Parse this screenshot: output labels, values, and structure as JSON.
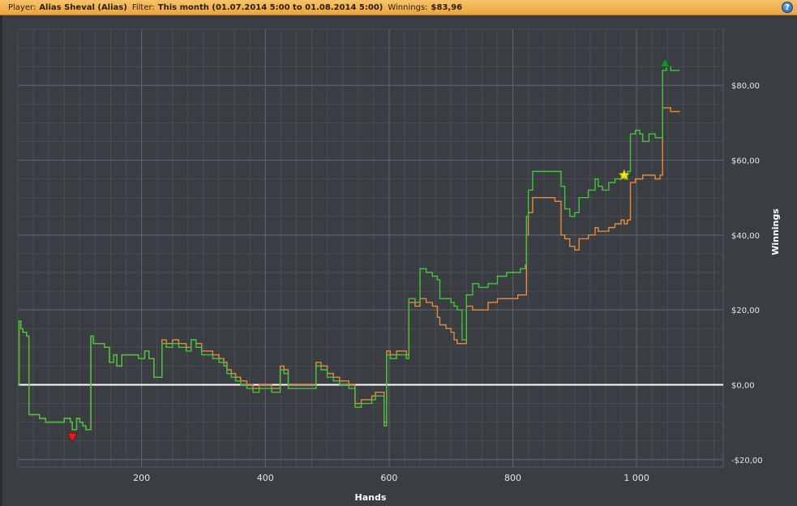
{
  "header": {
    "player_label": "Player:",
    "player_value": "Alias Sheval (Alias)",
    "filter_label": "Filter:",
    "filter_value": "This month (01.07.2014 5:00 to 01.08.2014 5:00)",
    "winnings_label": "Winnings:",
    "winnings_value": "$83,96",
    "help_icon": "help-icon",
    "accent_color": "#f0aa45"
  },
  "chart_data": {
    "type": "line",
    "title": "",
    "xlabel": "Hands",
    "ylabel": "Winnings",
    "xlim": [
      0,
      1140
    ],
    "ylim": [
      -22,
      95
    ],
    "xticks": [
      200,
      400,
      600,
      800,
      1000
    ],
    "xtick_labels": [
      "200",
      "400",
      "600",
      "800",
      "1 000"
    ],
    "yticks": [
      -20,
      0,
      20,
      40,
      60,
      80
    ],
    "ytick_labels": [
      "-$20,00",
      "$0,00",
      "$20,00",
      "$40,00",
      "$60,00",
      "$80,00"
    ],
    "grid": true,
    "background_color": "#3a3d42",
    "zero_line_color": "#ffffff",
    "series": [
      {
        "color": "#45c43e",
        "points": [
          [
            0,
            0
          ],
          [
            2,
            17
          ],
          [
            5,
            15
          ],
          [
            8,
            14
          ],
          [
            14,
            13
          ],
          [
            18,
            -8
          ],
          [
            25,
            -8
          ],
          [
            35,
            -9
          ],
          [
            45,
            -10
          ],
          [
            55,
            -10
          ],
          [
            65,
            -10
          ],
          [
            75,
            -9
          ],
          [
            85,
            -10
          ],
          [
            88,
            -12
          ],
          [
            95,
            -9
          ],
          [
            100,
            -10
          ],
          [
            105,
            -11
          ],
          [
            110,
            -12
          ],
          [
            116,
            -12
          ],
          [
            118,
            13
          ],
          [
            122,
            11
          ],
          [
            130,
            11
          ],
          [
            140,
            10
          ],
          [
            148,
            6
          ],
          [
            155,
            8
          ],
          [
            160,
            5
          ],
          [
            168,
            8
          ],
          [
            175,
            8
          ],
          [
            185,
            8
          ],
          [
            195,
            7
          ],
          [
            205,
            9
          ],
          [
            212,
            7
          ],
          [
            220,
            2
          ],
          [
            228,
            2
          ],
          [
            233,
            11
          ],
          [
            240,
            10
          ],
          [
            250,
            11
          ],
          [
            260,
            10
          ],
          [
            272,
            9
          ],
          [
            280,
            12
          ],
          [
            288,
            10
          ],
          [
            297,
            8
          ],
          [
            305,
            8
          ],
          [
            315,
            7
          ],
          [
            325,
            6
          ],
          [
            333,
            5
          ],
          [
            338,
            3
          ],
          [
            345,
            2
          ],
          [
            352,
            1
          ],
          [
            360,
            0
          ],
          [
            370,
            -1
          ],
          [
            380,
            -2
          ],
          [
            390,
            -1
          ],
          [
            400,
            -1
          ],
          [
            410,
            -2
          ],
          [
            418,
            -2
          ],
          [
            424,
            4
          ],
          [
            430,
            3
          ],
          [
            437,
            -1
          ],
          [
            445,
            -1
          ],
          [
            455,
            -1
          ],
          [
            470,
            -1
          ],
          [
            478,
            -1
          ],
          [
            482,
            5
          ],
          [
            490,
            4
          ],
          [
            500,
            2
          ],
          [
            510,
            1
          ],
          [
            520,
            0
          ],
          [
            535,
            -1
          ],
          [
            545,
            -6
          ],
          [
            555,
            -5
          ],
          [
            565,
            -5
          ],
          [
            572,
            -4
          ],
          [
            578,
            -3
          ],
          [
            585,
            -3
          ],
          [
            592,
            -11
          ],
          [
            596,
            8
          ],
          [
            602,
            7
          ],
          [
            612,
            8
          ],
          [
            620,
            8
          ],
          [
            628,
            7
          ],
          [
            632,
            23
          ],
          [
            642,
            22
          ],
          [
            650,
            31
          ],
          [
            660,
            30
          ],
          [
            670,
            29
          ],
          [
            678,
            28
          ],
          [
            682,
            23
          ],
          [
            692,
            23
          ],
          [
            700,
            22
          ],
          [
            705,
            21
          ],
          [
            710,
            20
          ],
          [
            718,
            12
          ],
          [
            725,
            24
          ],
          [
            735,
            27
          ],
          [
            745,
            26
          ],
          [
            760,
            27
          ],
          [
            775,
            29
          ],
          [
            790,
            30
          ],
          [
            808,
            30
          ],
          [
            812,
            31
          ],
          [
            820,
            32
          ],
          [
            822,
            45
          ],
          [
            825,
            52
          ],
          [
            832,
            57
          ],
          [
            845,
            57
          ],
          [
            862,
            57
          ],
          [
            868,
            57
          ],
          [
            878,
            53
          ],
          [
            884,
            47
          ],
          [
            892,
            45
          ],
          [
            900,
            46
          ],
          [
            907,
            50
          ],
          [
            915,
            50
          ],
          [
            922,
            52
          ],
          [
            930,
            52
          ],
          [
            933,
            55
          ],
          [
            938,
            53
          ],
          [
            945,
            52
          ],
          [
            955,
            54
          ],
          [
            965,
            55
          ],
          [
            975,
            56
          ],
          [
            980,
            55
          ],
          [
            985,
            57
          ],
          [
            990,
            67
          ],
          [
            998,
            68
          ],
          [
            1005,
            67
          ],
          [
            1010,
            65
          ],
          [
            1020,
            67
          ],
          [
            1030,
            66
          ],
          [
            1038,
            66
          ],
          [
            1042,
            84
          ],
          [
            1048,
            85
          ],
          [
            1055,
            84
          ],
          [
            1065,
            84
          ],
          [
            1070,
            84
          ]
        ]
      },
      {
        "color": "#e8893c",
        "points": [
          [
            0,
            0
          ],
          [
            2,
            17
          ],
          [
            5,
            15
          ],
          [
            8,
            14
          ],
          [
            14,
            13
          ],
          [
            18,
            -8
          ],
          [
            25,
            -8
          ],
          [
            35,
            -9
          ],
          [
            45,
            -10
          ],
          [
            55,
            -10
          ],
          [
            65,
            -10
          ],
          [
            75,
            -9
          ],
          [
            85,
            -10
          ],
          [
            88,
            -12
          ],
          [
            95,
            -9
          ],
          [
            100,
            -10
          ],
          [
            105,
            -11
          ],
          [
            110,
            -12
          ],
          [
            116,
            -12
          ],
          [
            118,
            13
          ],
          [
            122,
            11
          ],
          [
            130,
            11
          ],
          [
            140,
            10
          ],
          [
            148,
            6
          ],
          [
            155,
            8
          ],
          [
            160,
            5
          ],
          [
            168,
            8
          ],
          [
            175,
            8
          ],
          [
            185,
            8
          ],
          [
            195,
            7
          ],
          [
            205,
            9
          ],
          [
            212,
            7
          ],
          [
            220,
            2
          ],
          [
            228,
            2
          ],
          [
            233,
            12
          ],
          [
            240,
            11
          ],
          [
            250,
            12
          ],
          [
            260,
            11
          ],
          [
            272,
            10
          ],
          [
            280,
            12
          ],
          [
            288,
            11
          ],
          [
            297,
            9
          ],
          [
            305,
            9
          ],
          [
            315,
            8
          ],
          [
            325,
            7
          ],
          [
            333,
            6
          ],
          [
            338,
            4
          ],
          [
            345,
            3
          ],
          [
            352,
            2
          ],
          [
            360,
            1
          ],
          [
            370,
            0
          ],
          [
            380,
            -1
          ],
          [
            390,
            0
          ],
          [
            400,
            0
          ],
          [
            410,
            -1
          ],
          [
            418,
            -1
          ],
          [
            424,
            5
          ],
          [
            430,
            4
          ],
          [
            437,
            0
          ],
          [
            445,
            0
          ],
          [
            455,
            0
          ],
          [
            470,
            0
          ],
          [
            478,
            0
          ],
          [
            482,
            6
          ],
          [
            490,
            5
          ],
          [
            500,
            3
          ],
          [
            510,
            2
          ],
          [
            520,
            1
          ],
          [
            535,
            0
          ],
          [
            545,
            -5
          ],
          [
            555,
            -4
          ],
          [
            565,
            -4
          ],
          [
            572,
            -3
          ],
          [
            578,
            -2
          ],
          [
            585,
            -2
          ],
          [
            592,
            -10
          ],
          [
            596,
            9
          ],
          [
            602,
            8
          ],
          [
            612,
            9
          ],
          [
            620,
            9
          ],
          [
            628,
            8
          ],
          [
            632,
            22
          ],
          [
            642,
            21
          ],
          [
            650,
            23
          ],
          [
            660,
            22
          ],
          [
            670,
            21
          ],
          [
            678,
            18
          ],
          [
            682,
            16
          ],
          [
            692,
            15
          ],
          [
            700,
            14
          ],
          [
            705,
            12
          ],
          [
            710,
            11
          ],
          [
            718,
            11
          ],
          [
            725,
            21
          ],
          [
            735,
            20
          ],
          [
            745,
            20
          ],
          [
            760,
            22
          ],
          [
            775,
            23
          ],
          [
            790,
            23
          ],
          [
            808,
            24
          ],
          [
            812,
            24
          ],
          [
            820,
            24
          ],
          [
            822,
            40
          ],
          [
            825,
            46
          ],
          [
            832,
            50
          ],
          [
            845,
            50
          ],
          [
            862,
            50
          ],
          [
            868,
            49
          ],
          [
            878,
            40
          ],
          [
            884,
            39
          ],
          [
            892,
            37
          ],
          [
            900,
            36
          ],
          [
            907,
            39
          ],
          [
            915,
            39
          ],
          [
            922,
            40
          ],
          [
            930,
            40
          ],
          [
            933,
            42
          ],
          [
            938,
            41
          ],
          [
            945,
            41
          ],
          [
            955,
            42
          ],
          [
            965,
            43
          ],
          [
            975,
            44
          ],
          [
            980,
            43
          ],
          [
            985,
            44
          ],
          [
            990,
            54
          ],
          [
            998,
            55
          ],
          [
            1005,
            55
          ],
          [
            1010,
            56
          ],
          [
            1020,
            56
          ],
          [
            1030,
            55
          ],
          [
            1038,
            56
          ],
          [
            1042,
            74
          ],
          [
            1048,
            74
          ],
          [
            1055,
            73
          ],
          [
            1065,
            73
          ],
          [
            1070,
            73
          ]
        ]
      }
    ],
    "markers": [
      {
        "name": "min-marker",
        "shape": "triangle-down",
        "x": 88,
        "y": -14,
        "color": "#e01b1b"
      },
      {
        "name": "max-marker",
        "shape": "triangle-up",
        "x": 1046,
        "y": 86,
        "color": "#1c8a2a"
      },
      {
        "name": "star-marker",
        "shape": "star",
        "x": 980,
        "y": 56,
        "color": "#f6e11b"
      }
    ]
  }
}
